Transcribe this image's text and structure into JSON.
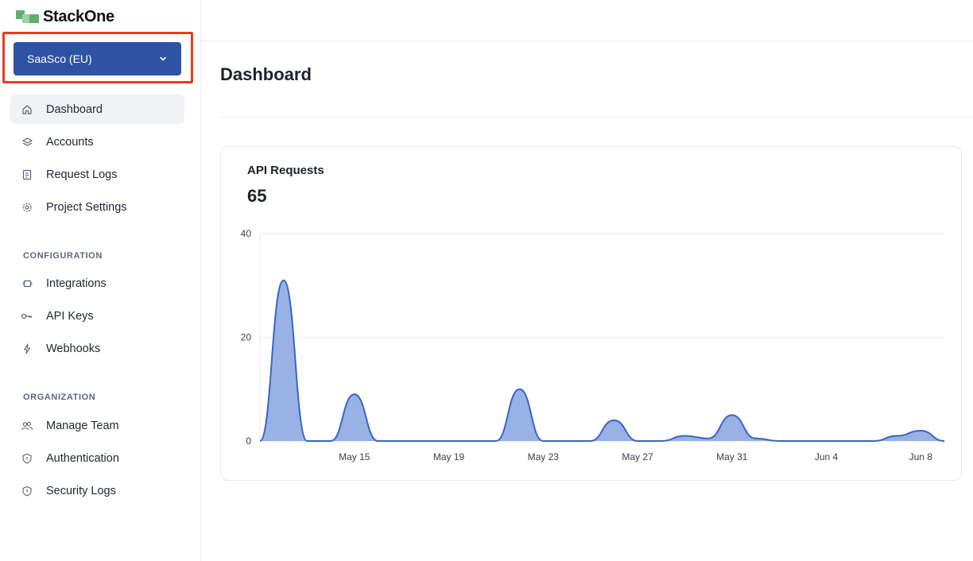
{
  "app": {
    "name": "StackOne"
  },
  "project_selector": {
    "label": "SaaSco (EU)"
  },
  "nav": {
    "main": [
      {
        "label": "Dashboard",
        "icon": "home-icon",
        "active": true
      },
      {
        "label": "Accounts",
        "icon": "layers-icon"
      },
      {
        "label": "Request Logs",
        "icon": "document-icon"
      },
      {
        "label": "Project Settings",
        "icon": "gear-icon"
      }
    ],
    "configuration_label": "CONFIGURATION",
    "configuration": [
      {
        "label": "Integrations",
        "icon": "plug-icon"
      },
      {
        "label": "API Keys",
        "icon": "key-icon"
      },
      {
        "label": "Webhooks",
        "icon": "bolt-icon"
      }
    ],
    "organization_label": "ORGANIZATION",
    "organization": [
      {
        "label": "Manage Team",
        "icon": "users-icon"
      },
      {
        "label": "Authentication",
        "icon": "shield-icon"
      },
      {
        "label": "Security Logs",
        "icon": "shield-icon"
      }
    ]
  },
  "page": {
    "title": "Dashboard"
  },
  "card": {
    "title": "API Requests",
    "value": "65"
  },
  "colors": {
    "accent": "#2e52a4",
    "highlight": "#ee3a1c",
    "area_fill": "#98b2e6",
    "area_stroke": "#3a64c8"
  },
  "chart_data": {
    "type": "area",
    "title": "API Requests",
    "x_tick_labels": [
      "May 15",
      "May 19",
      "May 23",
      "May 27",
      "May 31",
      "Jun 4",
      "Jun 8"
    ],
    "y_tick_labels": [
      "0",
      "20",
      "40"
    ],
    "ylim": [
      0,
      40
    ],
    "grid": true,
    "x": [
      "May 11",
      "May 12",
      "May 13",
      "May 14",
      "May 15",
      "May 16",
      "May 17",
      "May 18",
      "May 19",
      "May 20",
      "May 21",
      "May 22",
      "May 23",
      "May 24",
      "May 25",
      "May 26",
      "May 27",
      "May 28",
      "May 29",
      "May 30",
      "May 31",
      "Jun 1",
      "Jun 2",
      "Jun 3",
      "Jun 4",
      "Jun 5",
      "Jun 6",
      "Jun 7",
      "Jun 8",
      "Jun 9"
    ],
    "values": [
      0,
      31,
      0,
      0,
      9,
      0,
      0,
      0,
      0,
      0,
      0,
      10,
      0,
      0,
      0,
      4,
      0,
      0,
      1,
      0.5,
      5,
      0.5,
      0,
      0,
      0,
      0,
      0,
      1,
      2,
      0
    ]
  }
}
